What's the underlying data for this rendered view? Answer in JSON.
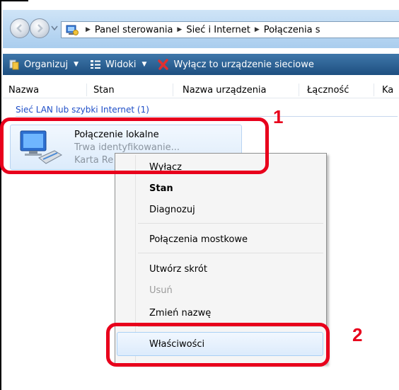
{
  "address": {
    "crumbs": [
      "Panel sterowania",
      "Sieć i Internet",
      "Połączenia s"
    ]
  },
  "toolbar": {
    "organize_label": "Organizuj",
    "views_label": "Widoki",
    "disable_label": "Wyłącz to urządzenie sieciowe"
  },
  "columns": [
    "Nazwa",
    "Stan",
    "Nazwa urządzenia",
    "Łączność",
    "Ka"
  ],
  "group": {
    "header": "Sieć LAN lub szybki Internet (1)"
  },
  "item": {
    "name": "Połączenie lokalne",
    "status": "Trwa identyfikowanie...",
    "device": "Karta Re"
  },
  "menu": {
    "items": [
      "Wyłącz",
      "Stan",
      "Diagnozuj",
      "Połączenia mostkowe",
      "Utwórz skrót",
      "Usuń",
      "Zmień nazwę",
      "Właściwości"
    ]
  },
  "annotations": {
    "label_1": "1",
    "label_2": "2"
  },
  "colors": {
    "accent_red": "#e8001c",
    "toolbar_blue": "#2a5f93",
    "link_blue": "#1e4ec8"
  }
}
